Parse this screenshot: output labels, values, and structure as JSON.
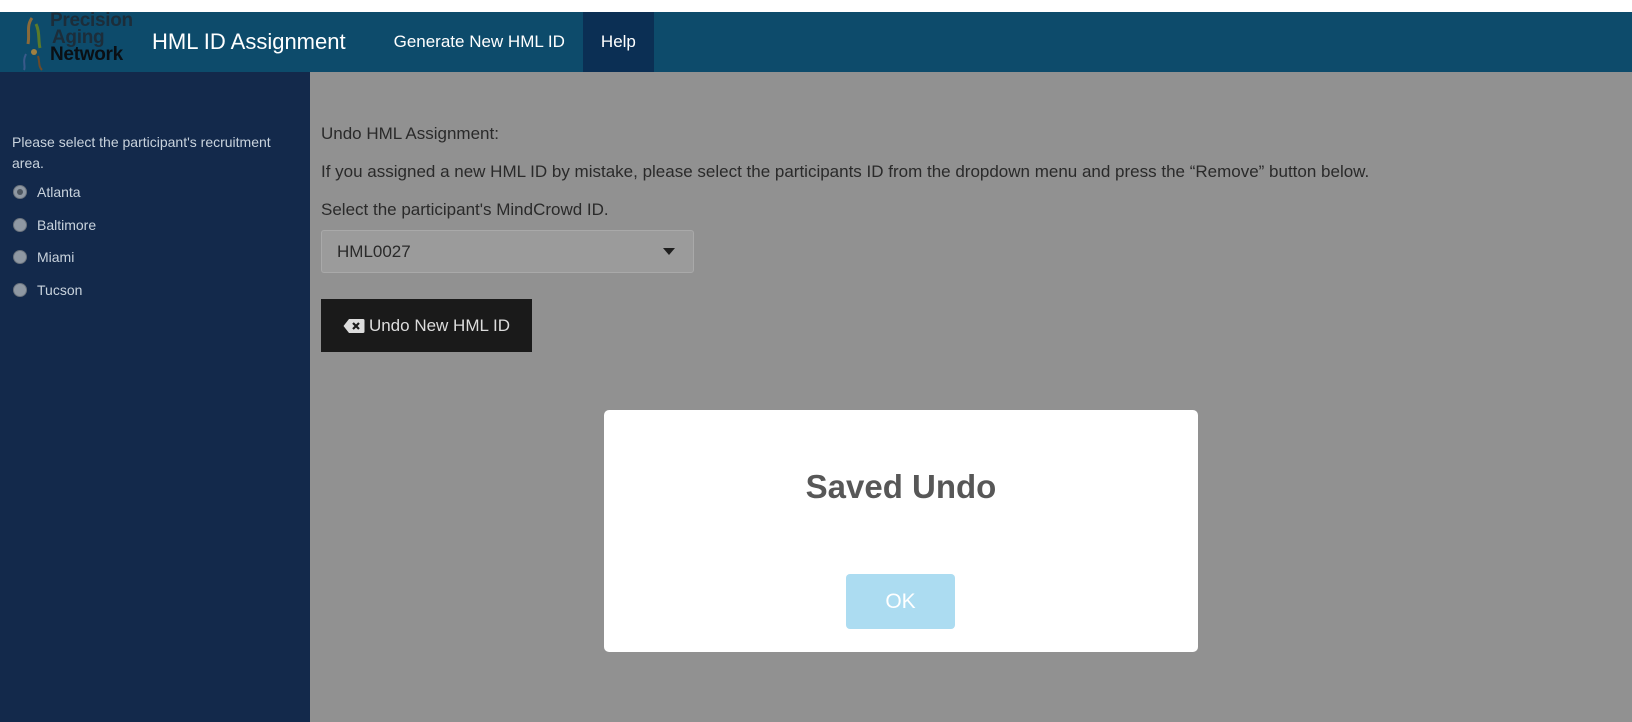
{
  "navbar": {
    "logo": {
      "line1": "Precision",
      "line2": "Aging",
      "line3": "Network"
    },
    "app_title": "HML ID Assignment",
    "items": [
      {
        "label": "Generate New HML ID",
        "active": false
      },
      {
        "label": "Help",
        "active": true
      }
    ]
  },
  "sidebar": {
    "label": "Please select the participant's recruitment area.",
    "options": [
      {
        "label": "Atlanta",
        "checked": true
      },
      {
        "label": "Baltimore",
        "checked": false
      },
      {
        "label": "Miami",
        "checked": false
      },
      {
        "label": "Tucson",
        "checked": false
      }
    ]
  },
  "main": {
    "section_title": "Undo HML Assignment:",
    "instructions": "If you assigned a new HML ID by mistake, please select the participants ID from the dropdown menu and press the “Remove” button below.",
    "select_label": "Select the participant's MindCrowd ID.",
    "selected_id": "HML0027",
    "undo_button_label": "Undo New HML ID"
  },
  "modal": {
    "title": "Saved Undo",
    "ok_label": "OK"
  },
  "colors": {
    "navbar": "#0d4b6b",
    "navbar_active": "#0b2f54",
    "sidebar": "#13294b",
    "overlay": "#919191",
    "ok_button": "#acdcf1"
  }
}
